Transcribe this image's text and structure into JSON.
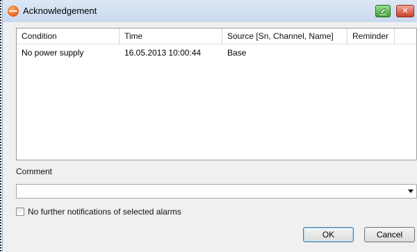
{
  "window": {
    "title": "Acknowledgement",
    "app_icon": "testo-logo-icon",
    "help_icon": "pencil-help-icon",
    "close_symbol": "✕"
  },
  "alarm_table": {
    "columns": [
      "Condition",
      "Time",
      "Source [Sn, Channel, Name]",
      "Reminder"
    ],
    "rows": [
      [
        "No power supply",
        "16.05.2013 10:00:44",
        "Base",
        ""
      ]
    ]
  },
  "comment": {
    "label": "Comment",
    "value": ""
  },
  "suppress_checkbox": {
    "label": "No further notifications of selected alarms",
    "checked": false
  },
  "buttons": {
    "ok": "OK",
    "cancel": "Cancel"
  }
}
